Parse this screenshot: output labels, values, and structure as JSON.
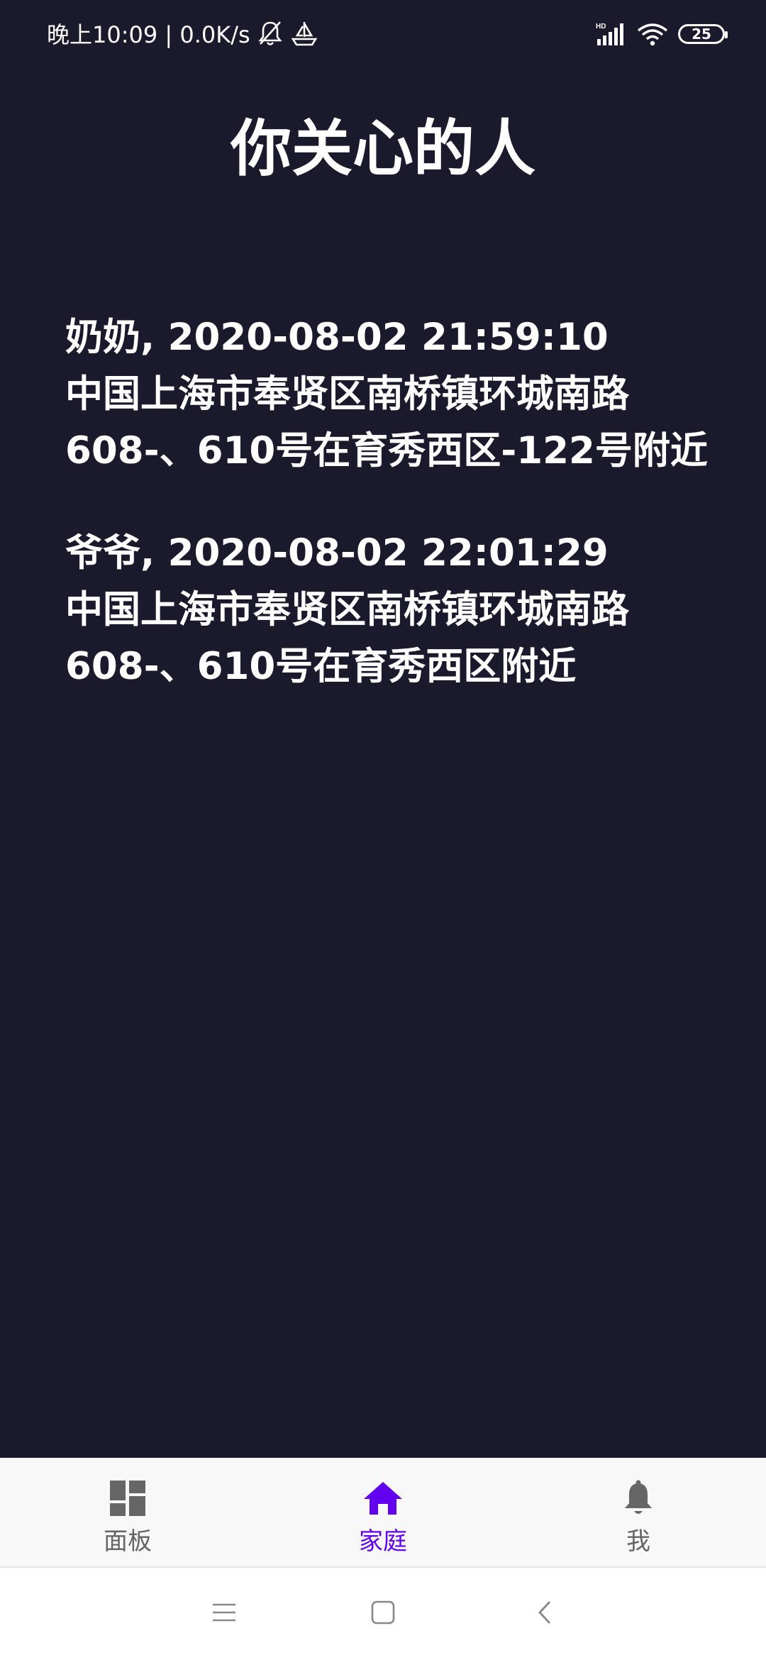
{
  "status_bar": {
    "left_text": "晚上10:09 | 0.0K/s",
    "battery": "25",
    "signal_label": "HD"
  },
  "page": {
    "title": "你关心的人"
  },
  "records": [
    {
      "line1": "奶奶, 2020-08-02 21:59:10",
      "line2": "中国上海市奉贤区南桥镇环城南路",
      "line3": "608-、610号在育秀西区-122号附近"
    },
    {
      "line1": "爷爷, 2020-08-02 22:01:29",
      "line2": "中国上海市奉贤区南桥镇环城南路",
      "line3": "608-、610号在育秀西区附近"
    }
  ],
  "bottom_nav": {
    "items": [
      {
        "label": "面板",
        "icon": "dashboard-icon"
      },
      {
        "label": "家庭",
        "icon": "home-icon",
        "active": true
      },
      {
        "label": "我",
        "icon": "bell-icon"
      }
    ]
  },
  "system_nav": {
    "buttons": [
      "menu-icon",
      "home-square-icon",
      "back-chevron-icon"
    ]
  },
  "colors": {
    "background": "#1a1a2c",
    "accent": "#6200ee",
    "nav_inactive": "#666666",
    "nav_background": "#f8f8f8"
  }
}
